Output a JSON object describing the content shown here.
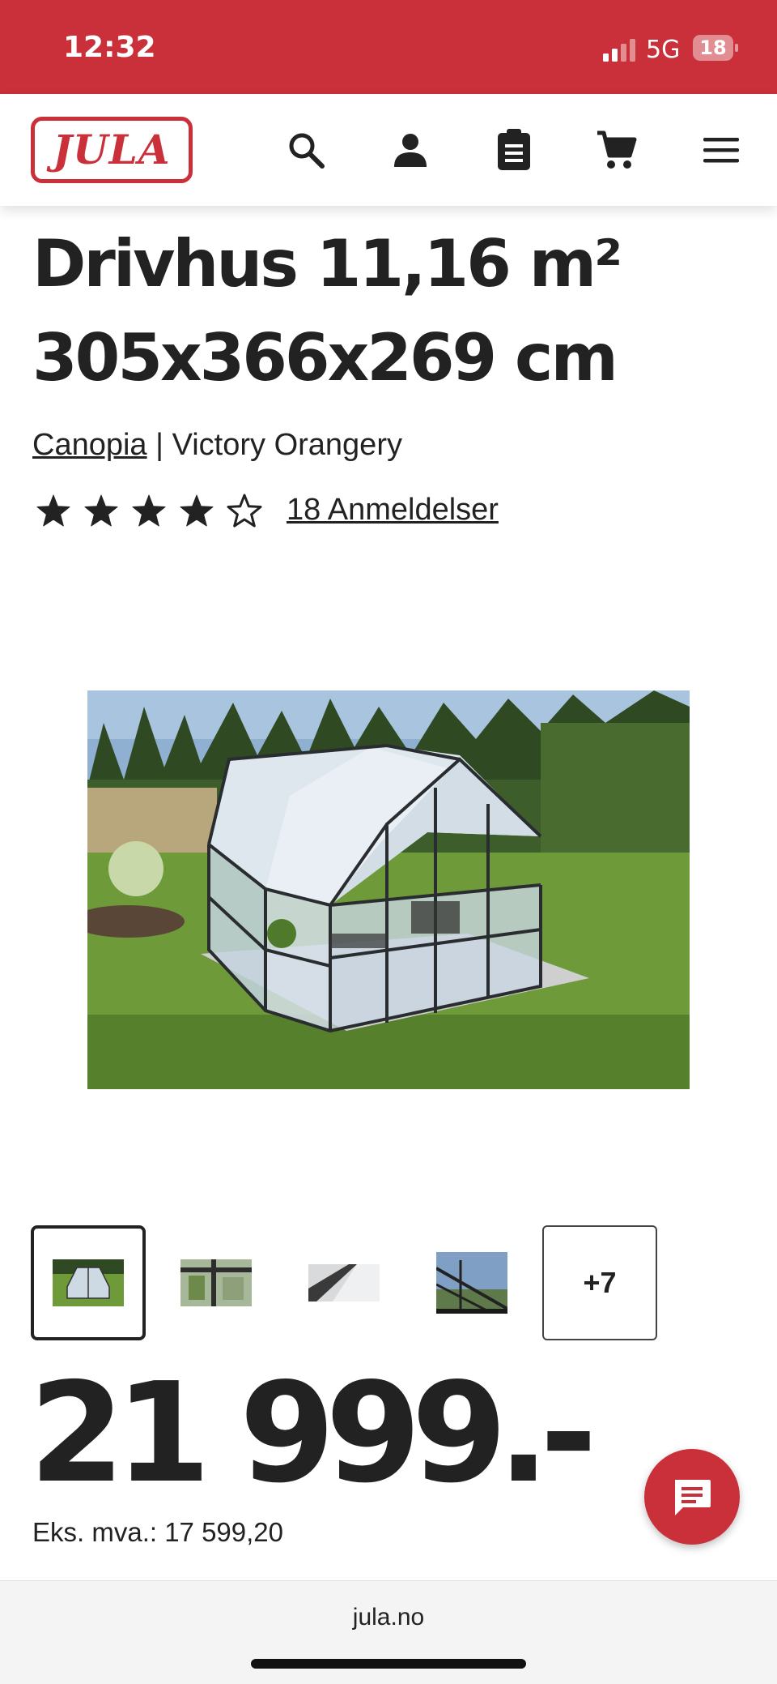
{
  "status_bar": {
    "time": "12:32",
    "network": "5G",
    "battery": "18"
  },
  "header": {
    "logo_text": "JULA",
    "icons": [
      "search-icon",
      "account-icon",
      "shopping-list-icon",
      "cart-icon",
      "menu-icon"
    ]
  },
  "product": {
    "title_line1": "Drivhus 11,16 m²",
    "title_line2": "305x366x269 cm",
    "brand": "Canopia",
    "separator": " | ",
    "model": "Victory Orangery",
    "rating": {
      "value": 4,
      "max": 5
    },
    "reviews_label": "18 Anmeldelser",
    "more_images_label": "+7",
    "price": "21 999.-",
    "ex_vat": "Eks. mva.: 17 599,20"
  },
  "browser": {
    "url": "jula.no"
  },
  "colors": {
    "brand_red": "#c9303a",
    "text": "#222222"
  }
}
